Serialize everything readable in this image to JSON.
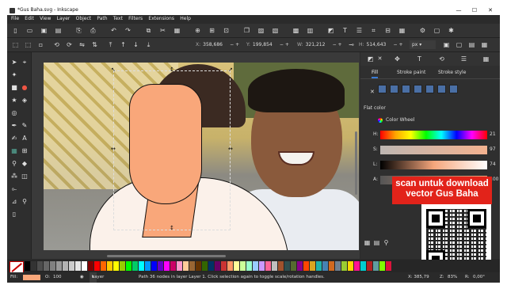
{
  "window": {
    "title": "*Gus Baha.svg - Inkscape",
    "minimize": "—",
    "maximize": "☐",
    "close": "✕"
  },
  "menu": [
    "File",
    "Edit",
    "View",
    "Layer",
    "Object",
    "Path",
    "Text",
    "Filters",
    "Extensions",
    "Help"
  ],
  "coords": {
    "x_label": "X:",
    "x": "358,686",
    "y_label": "Y:",
    "y": "199,854",
    "w_label": "W:",
    "w": "321,212",
    "h_label": "H:",
    "h": "514,643",
    "unit": "px"
  },
  "fill_stroke": {
    "tabs": [
      "Fill",
      "Stroke paint",
      "Stroke style"
    ],
    "flat_color": "Flat color",
    "wheel": "Color Wheel",
    "sliders": [
      {
        "label": "H:",
        "value": "21"
      },
      {
        "label": "S:",
        "value": "97"
      },
      {
        "label": "L:",
        "value": "74"
      },
      {
        "label": "A:",
        "value": "100"
      }
    ]
  },
  "overlay": {
    "line1": "scan untuk download",
    "line2": "vector Gus Baha"
  },
  "status": {
    "fill_label": "Fill:",
    "opacity_label": "O:",
    "opacity": "100",
    "layer": "Layer 1",
    "message": "Path 36 nodes in layer Layer 1. Click selection again to toggle scale/rotation handles.",
    "cursor_x": "X: 385,79",
    "zoom_label": "Z:",
    "zoom": "83%",
    "rotation_label": "R:",
    "rotation": "0,00°"
  },
  "palette": [
    "#000000",
    "#333333",
    "#4d4d4d",
    "#666666",
    "#808080",
    "#999999",
    "#b3b3b3",
    "#cccccc",
    "#e6e6e6",
    "#ffffff",
    "#800000",
    "#ff0000",
    "#ff6600",
    "#ffcc00",
    "#ffff00",
    "#99cc00",
    "#00ff00",
    "#00cc66",
    "#00ffff",
    "#0099ff",
    "#0000ff",
    "#6600cc",
    "#ff00ff",
    "#cc0066",
    "#ff99cc",
    "#ffcc99",
    "#996633",
    "#663300",
    "#336600",
    "#003366",
    "#660066",
    "#cc3333",
    "#ff9966",
    "#ffff99",
    "#ccff99",
    "#99ffcc",
    "#99ccff",
    "#cc99ff",
    "#ff6699",
    "#c0c0c0",
    "#a0522d",
    "#2f4f4f",
    "#556b2f",
    "#8b008b",
    "#ff4500",
    "#daa520",
    "#20b2aa",
    "#4682b4",
    "#d2691e",
    "#708090",
    "#9acd32",
    "#ffd700",
    "#ff1493",
    "#00ced1",
    "#b22222",
    "#5f9ea0",
    "#7fff00",
    "#dc143c"
  ],
  "colors": {
    "accent": "#3a7bd5",
    "overlay_bg": "#e2231a",
    "face_fill": "#f9a77a"
  }
}
